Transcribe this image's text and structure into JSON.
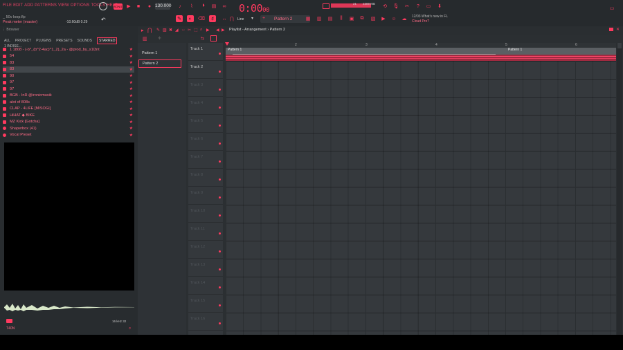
{
  "menu": [
    "FILE",
    "EDIT",
    "ADD",
    "PATTERNS",
    "VIEW",
    "OPTIONS",
    "TOOLS",
    "HELP"
  ],
  "hint": {
    "file": "_ 50v loop.flp",
    "meter": "Peak meter (master)",
    "db": "-10.60dB 0.29"
  },
  "transport": {
    "tempo": "130.000",
    "time_main": "0:00",
    "time_sub": "00",
    "snap": "Line",
    "pattern": "Pattern 2"
  },
  "cpu": {
    "mem": "2389 MB",
    "voices": "21"
  },
  "news": {
    "line1": "12/03 What's new in FL",
    "line2": "Cloud Pro?"
  },
  "browser": {
    "title": "Browser",
    "tabs": [
      "ALL",
      "PROJECT",
      "PLUGINS",
      "PRESETS",
      "SOUNDS",
      "STARRED",
      "1 INDISE..."
    ],
    "items": [
      "1 1808 - (-b*_(b^2-4ac)^1_2)_2a - @prod_by_s1l3nt",
      "54",
      "83",
      "83",
      "90",
      "97",
      "97",
      "BGB - InR @ironicmusik",
      "alot of 808s",
      "CLAP - 4LIFE [MISOGI]",
      "HiHAT ◆ BIKE",
      "MZ Kick [Gotcha]",
      "Shaperbox (41)",
      "Vocal Preset"
    ],
    "footer_left": "T40N",
    "footer_info": "16 kHz 32"
  },
  "playlist": {
    "title": "Playlist - Arrangement › Pattern 2",
    "patterns": [
      "Pattern 1",
      "Pattern 2"
    ],
    "tracks": [
      "Track 1",
      "Track 2",
      "Track 3",
      "Track 4",
      "Track 5",
      "Track 6",
      "Track 7",
      "Track 8",
      "Track 9",
      "Track 10",
      "Track 11",
      "Track 12",
      "Track 13",
      "Track 14",
      "Track 15",
      "Track 16"
    ],
    "bars": [
      "2",
      "3",
      "4",
      "5",
      "6"
    ],
    "clip_label": "Pattern 1"
  },
  "colors": {
    "accent": "#ff3a5f",
    "bg": "#2b2f32"
  }
}
